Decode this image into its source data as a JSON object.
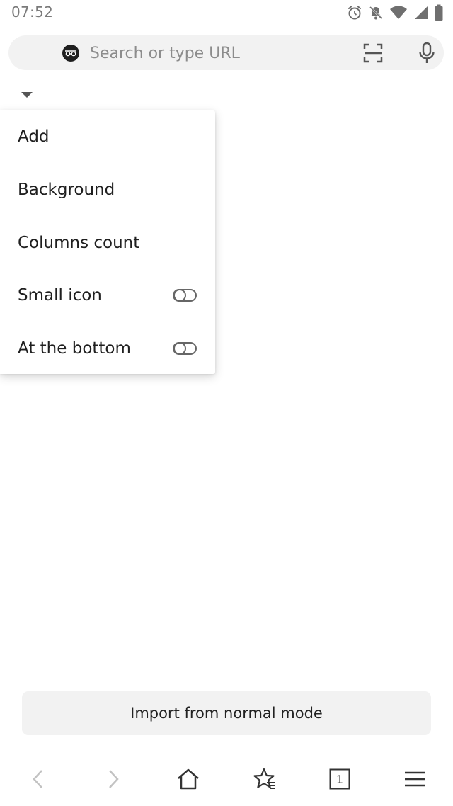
{
  "status_bar": {
    "time": "07:52",
    "icons": [
      "alarm-icon",
      "notifications-off-icon",
      "wifi-icon",
      "cell-signal-icon",
      "battery-icon"
    ]
  },
  "url_bar": {
    "placeholder": "Search or type URL",
    "value": "",
    "left_icon": "incognito-icon",
    "right_icons": [
      "scan-icon",
      "microphone-icon"
    ]
  },
  "menu": {
    "items": [
      {
        "label": "Add",
        "toggle": null
      },
      {
        "label": "Background",
        "toggle": null
      },
      {
        "label": "Columns count",
        "toggle": null
      },
      {
        "label": "Small icon",
        "toggle": "off"
      },
      {
        "label": "At the bottom",
        "toggle": "off"
      }
    ]
  },
  "import_button": {
    "label": "Import from normal mode"
  },
  "bottom_nav": {
    "items": [
      "back-icon",
      "forward-icon",
      "home-icon",
      "bookmarks-icon",
      "tabs-icon",
      "menu-icon"
    ],
    "tab_count": "1"
  },
  "colors": {
    "background": "#ffffff",
    "url_bar_bg": "#f2f2f2",
    "button_bg": "#f2f2f2",
    "text": "#1f1f1f",
    "muted_text": "#8c8c8c"
  }
}
